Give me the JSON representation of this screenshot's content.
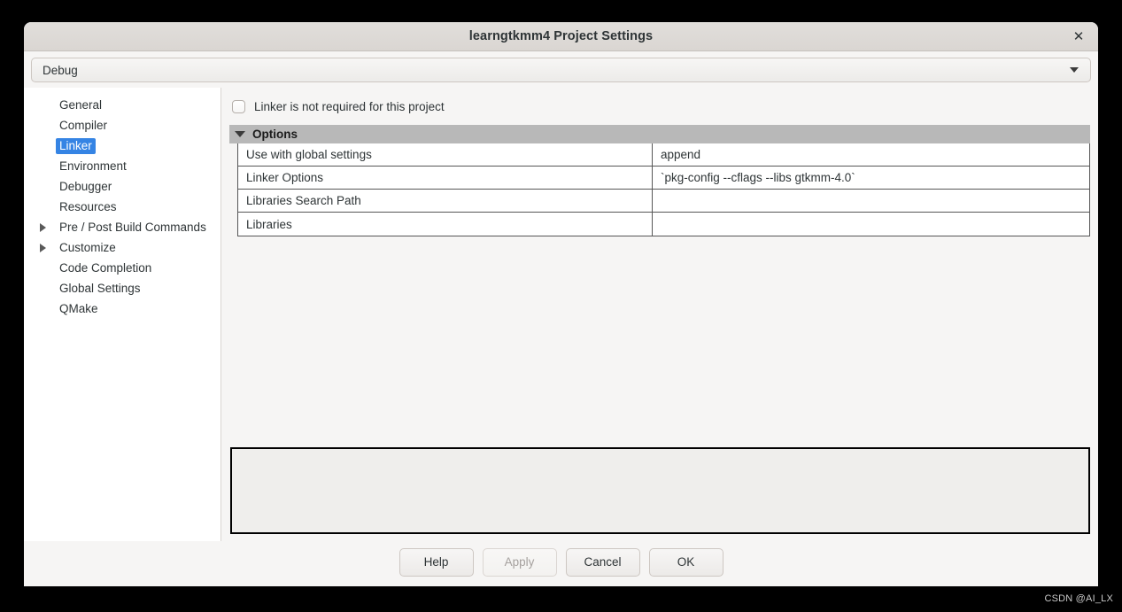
{
  "window": {
    "title": "learngtkmm4 Project Settings",
    "close_icon": "close-icon"
  },
  "config_combo": {
    "value": "Debug",
    "arrow_icon": "chevron-down-icon"
  },
  "sidebar": {
    "items": [
      {
        "label": "General",
        "expandable": false,
        "selected": false
      },
      {
        "label": "Compiler",
        "expandable": false,
        "selected": false
      },
      {
        "label": "Linker",
        "expandable": false,
        "selected": true
      },
      {
        "label": "Environment",
        "expandable": false,
        "selected": false
      },
      {
        "label": "Debugger",
        "expandable": false,
        "selected": false
      },
      {
        "label": "Resources",
        "expandable": false,
        "selected": false
      },
      {
        "label": "Pre / Post Build Commands",
        "expandable": true,
        "selected": false
      },
      {
        "label": "Customize",
        "expandable": true,
        "selected": false
      },
      {
        "label": "Code Completion",
        "expandable": false,
        "selected": false
      },
      {
        "label": "Global Settings",
        "expandable": false,
        "selected": false
      },
      {
        "label": "QMake",
        "expandable": false,
        "selected": false
      }
    ]
  },
  "content": {
    "checkbox": {
      "label": "Linker is not required for this project",
      "checked": false
    },
    "group": {
      "title": "Options",
      "expanded": true,
      "expander_icon": "triangle-down-icon"
    },
    "table": {
      "rows": [
        {
          "key": "Use with global settings",
          "value": "append"
        },
        {
          "key": "Linker Options",
          "value": "`pkg-config --cflags --libs gtkmm-4.0`"
        },
        {
          "key": "Libraries Search Path",
          "value": ""
        },
        {
          "key": "Libraries",
          "value": ""
        }
      ]
    },
    "description": ""
  },
  "footer": {
    "buttons": [
      {
        "label": "Help",
        "disabled": false
      },
      {
        "label": "Apply",
        "disabled": true
      },
      {
        "label": "Cancel",
        "disabled": false
      },
      {
        "label": "OK",
        "disabled": false
      }
    ]
  },
  "watermark": "CSDN @AI_LX",
  "colors": {
    "selection": "#3584e4",
    "group_header": "#b8b8b8",
    "window_bg": "#f6f5f4",
    "titlebar": "#ddd9d5"
  }
}
